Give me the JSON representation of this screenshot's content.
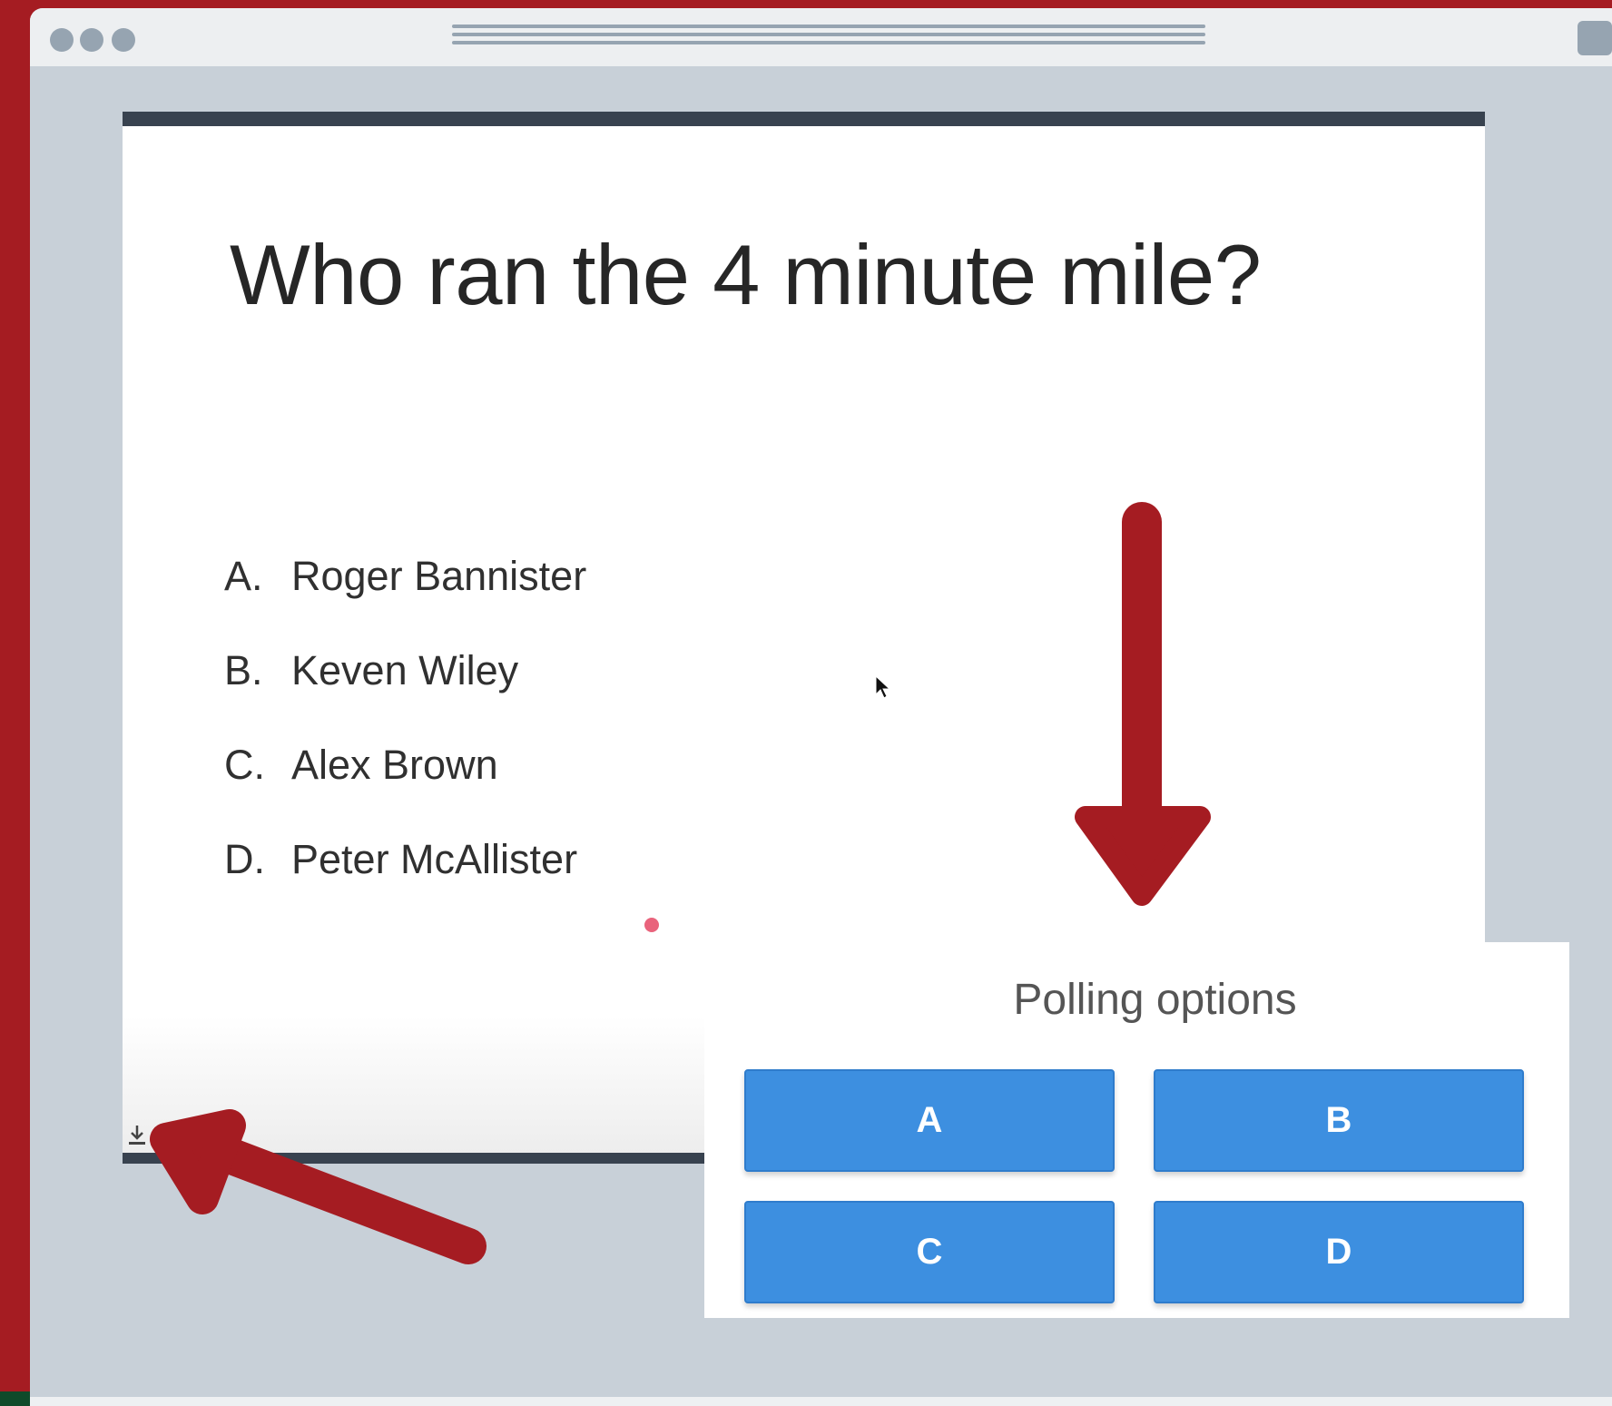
{
  "slide": {
    "question": "Who ran the 4 minute mile?",
    "options": [
      {
        "letter": "A.",
        "text": "Roger Bannister"
      },
      {
        "letter": "B.",
        "text": "Keven Wiley"
      },
      {
        "letter": "C.",
        "text": "Alex Brown"
      },
      {
        "letter": "D.",
        "text": "Peter McAllister"
      }
    ]
  },
  "polling": {
    "title": "Polling options",
    "buttons": [
      "A",
      "B",
      "C",
      "D"
    ]
  },
  "colors": {
    "brand_red": "#a51c22",
    "poll_button": "#3d8fe0",
    "slide_bar": "#38424f",
    "window_bg": "#c8d0d8"
  },
  "icons": {
    "download": "download-icon",
    "cursor": "cursor-icon"
  }
}
